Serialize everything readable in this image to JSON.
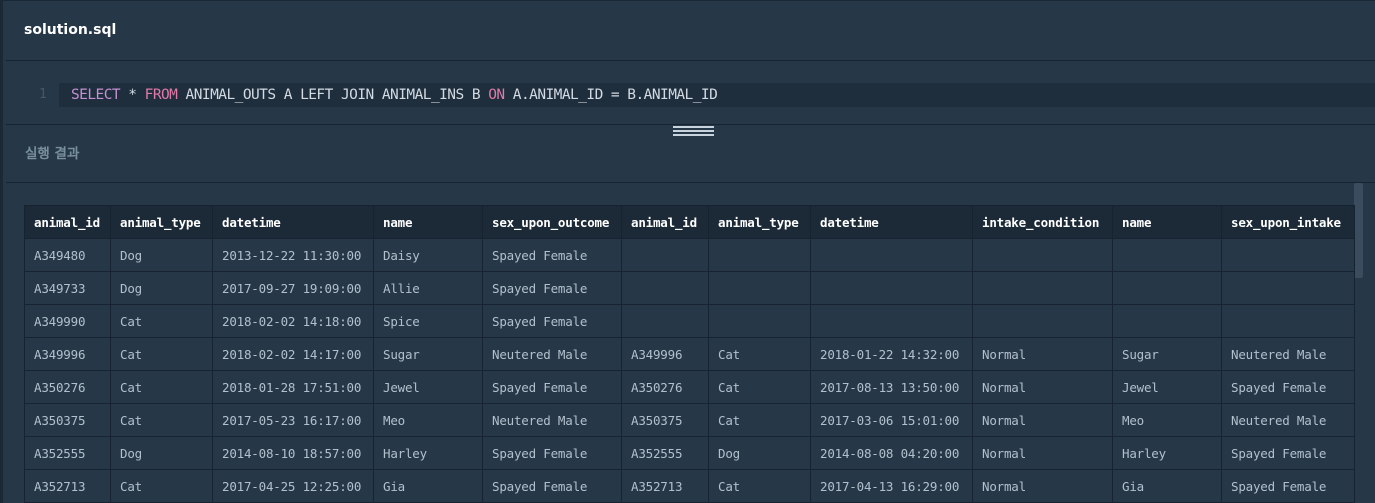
{
  "header": {
    "file_name": "solution.sql"
  },
  "editor": {
    "line_number": "1",
    "tokens": [
      {
        "text": "SELECT",
        "cls": "kw-purple"
      },
      {
        "text": " * ",
        "cls": ""
      },
      {
        "text": "FROM",
        "cls": "kw-pink"
      },
      {
        "text": " ANIMAL_OUTS A LEFT JOIN ANIMAL_INS B ",
        "cls": ""
      },
      {
        "text": "ON",
        "cls": "kw-pink"
      },
      {
        "text": " A.ANIMAL_ID = B.ANIMAL_ID",
        "cls": ""
      }
    ]
  },
  "results": {
    "title": "실행 결과",
    "columns": [
      "animal_id",
      "animal_type",
      "datetime",
      "name",
      "sex_upon_outcome",
      "animal_id",
      "animal_type",
      "datetime",
      "intake_condition",
      "name",
      "sex_upon_intake"
    ],
    "rows": [
      [
        "A349480",
        "Dog",
        "2013-12-22 11:30:00",
        "Daisy",
        "Spayed Female",
        "",
        "",
        "",
        "",
        "",
        ""
      ],
      [
        "A349733",
        "Dog",
        "2017-09-27 19:09:00",
        "Allie",
        "Spayed Female",
        "",
        "",
        "",
        "",
        "",
        ""
      ],
      [
        "A349990",
        "Cat",
        "2018-02-02 14:18:00",
        "Spice",
        "Spayed Female",
        "",
        "",
        "",
        "",
        "",
        ""
      ],
      [
        "A349996",
        "Cat",
        "2018-02-02 14:17:00",
        "Sugar",
        "Neutered Male",
        "A349996",
        "Cat",
        "2018-01-22 14:32:00",
        "Normal",
        "Sugar",
        "Neutered Male"
      ],
      [
        "A350276",
        "Cat",
        "2018-01-28 17:51:00",
        "Jewel",
        "Spayed Female",
        "A350276",
        "Cat",
        "2017-08-13 13:50:00",
        "Normal",
        "Jewel",
        "Spayed Female"
      ],
      [
        "A350375",
        "Cat",
        "2017-05-23 16:17:00",
        "Meo",
        "Neutered Male",
        "A350375",
        "Cat",
        "2017-03-06 15:01:00",
        "Normal",
        "Meo",
        "Neutered Male"
      ],
      [
        "A352555",
        "Dog",
        "2014-08-10 18:57:00",
        "Harley",
        "Spayed Female",
        "A352555",
        "Dog",
        "2014-08-08 04:20:00",
        "Normal",
        "Harley",
        "Spayed Female"
      ],
      [
        "A352713",
        "Cat",
        "2017-04-25 12:25:00",
        "Gia",
        "Spayed Female",
        "A352713",
        "Cat",
        "2017-04-13 16:29:00",
        "Normal",
        "Gia",
        "Spayed Female"
      ]
    ]
  }
}
